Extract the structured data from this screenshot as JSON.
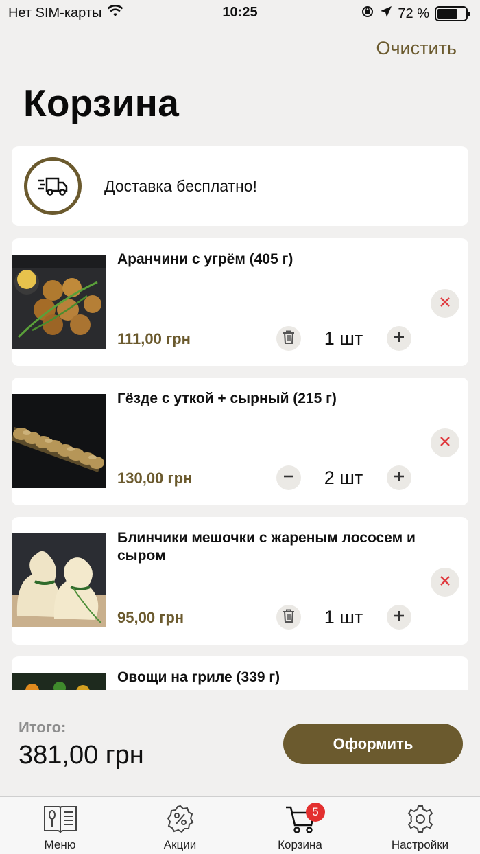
{
  "status_bar": {
    "carrier": "Нет SIM-карты",
    "time": "10:25",
    "battery": "72 %",
    "battery_level": 0.72
  },
  "header": {
    "clear_label": "Очистить",
    "title": "Корзина"
  },
  "delivery": {
    "text": "Доставка бесплатно!",
    "icon": "truck-icon"
  },
  "items": [
    {
      "title": "Аранчини с угрём (405 г)",
      "price": "111,00 грн",
      "quantity": "1 шт",
      "left_action": "trash-icon"
    },
    {
      "title": "Гёзде с уткой + сырный (215 г)",
      "price": "130,00 грн",
      "quantity": "2 шт",
      "left_action": "minus-icon"
    },
    {
      "title": "Блинчики мешочки с жареным лососем и сыром",
      "price": "95,00 грн",
      "quantity": "1 шт",
      "left_action": "trash-icon"
    },
    {
      "title": "Овощи на гриле (339 г)",
      "price": "",
      "quantity": "",
      "left_action": ""
    }
  ],
  "footer": {
    "total_label": "Итого:",
    "total_value": "381,00 грн",
    "checkout_label": "Оформить"
  },
  "tabs": [
    {
      "label": "Меню",
      "icon": "menu-book-icon"
    },
    {
      "label": "Акции",
      "icon": "discount-icon"
    },
    {
      "label": "Корзина",
      "icon": "cart-icon",
      "badge": "5"
    },
    {
      "label": "Настройки",
      "icon": "gear-icon"
    }
  ],
  "colors": {
    "accent": "#6b5a2e",
    "background": "#f1f0ef",
    "badge": "#e3302f",
    "remove_x": "#e0393e"
  }
}
